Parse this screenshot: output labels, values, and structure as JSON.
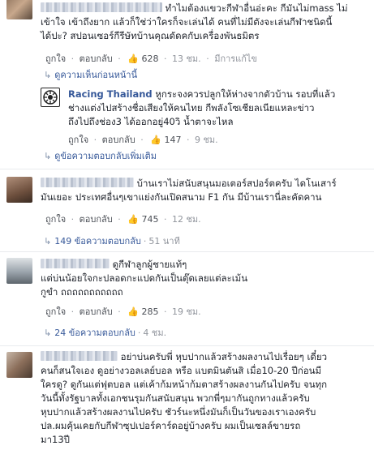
{
  "comments": [
    {
      "text_lines": [
        "ทำไมต้องแขวะกีฬาอื่นอ่ะคะ กีมันไม่mass ไม่",
        "เข้าใจ เข้าถึงยาก แล้วก็ใช่ว่าใครก็จะเล่นได้ คนที่ไม่มีตังจะเล่นกีฬาชนิดนี้",
        "ได้ปะ? สปอนเซอร์กีรีษัทบ้านคุณดัดคกับเครื่องพันธมิตร"
      ],
      "actions": {
        "like": "ถูกใจ",
        "reply": "ตอบกลับ",
        "likes": "628",
        "time": "13 ชม.",
        "edited": "มีการแก้ไข"
      },
      "earlier_replies": "ดูความเห็นก่อนหน้านี้",
      "reply": {
        "name": "Racing Thailand",
        "text_lines": [
          "หูกระจงควรปลูกให้ห่างจากตัวบ้าน รอบที่แล้ว",
          "ช่างแต่งไปสร้างชื่อเสียงให้คนไทย กีพลังโซเชียลเนียแหละข่าว",
          "ถึงไปถึงช่อง3 ได้ออกอยู่40วิ น้ำตาจะไหล"
        ],
        "actions": {
          "like": "ถูกใจ",
          "reply": "ตอบกลับ",
          "likes": "147",
          "time": "9 ชม."
        }
      },
      "more_replies": "ดูข้อความตอบกลับเพิ่มเติม"
    },
    {
      "text_lines": [
        "บ้านเราไม่สนับสนุนมอเตอร์สปอร์ตครับ ไดโนเสาร์",
        "มันเยอะ ประเทศอื่นๆเขาแย่งกันเปิดสนาม F1 กัน มีบ้านเรานี่ละคัดคาน"
      ],
      "actions": {
        "like": "ถูกใจ",
        "reply": "ตอบกลับ",
        "likes": "745",
        "time": "12 ชม."
      },
      "replies": {
        "count": "149 ข้อความตอบกลับ",
        "time": "51 นาที"
      }
    },
    {
      "text_lines": [
        "ดูกีฬาลูกผู้ชายแท้ๆ",
        "แต่บ่นน้อยใจกะปลอดกะแปดกันเป็นตุ๊ดเลยแต่ละเม้น",
        "กูขำ ถถถถถถถถถถถ"
      ],
      "actions": {
        "like": "ถูกใจ",
        "reply": "ตอบกลับ",
        "likes": "285",
        "time": "19 ชม."
      },
      "replies": {
        "count": "24 ข้อความตอบกลับ",
        "time": "4 ชม."
      }
    },
    {
      "text_lines": [
        "อย่าบ่นครับพี่ หุบปากแล้วสร้างผลงานไปเรื่อยๆ เดี๋ยว",
        "คนก็สนใจเอง ดูอย่างวอลเลย์บอล หรือ แบตมินตันสิ เมื่อ10-20 ปีก่อนมี",
        "ใครดู? ดูกันแต่ฟุตบอล แต่เค้าก้มหน้าก้มตาสร้างผลงานกันไปครับ จนทุก",
        "วันนี้ทั้งรัฐบาลทั้งเอกชนรุมกันสนับสนุน พวกพี่ๆมากันถูกทางแล้วครับ",
        "หุบปากแล้วสร้างผลงานไปครับ ชัวร์นะหนึ่งมันก็เป็นวันของเราเองครับ",
        "ปล.ผมคุ้นเคยกับกีฬาซุปเปอร์คาร์ดอยู่บ้างครับ ผมเป็นเซลล์ขายรถ",
        "มา13ปี"
      ]
    }
  ]
}
